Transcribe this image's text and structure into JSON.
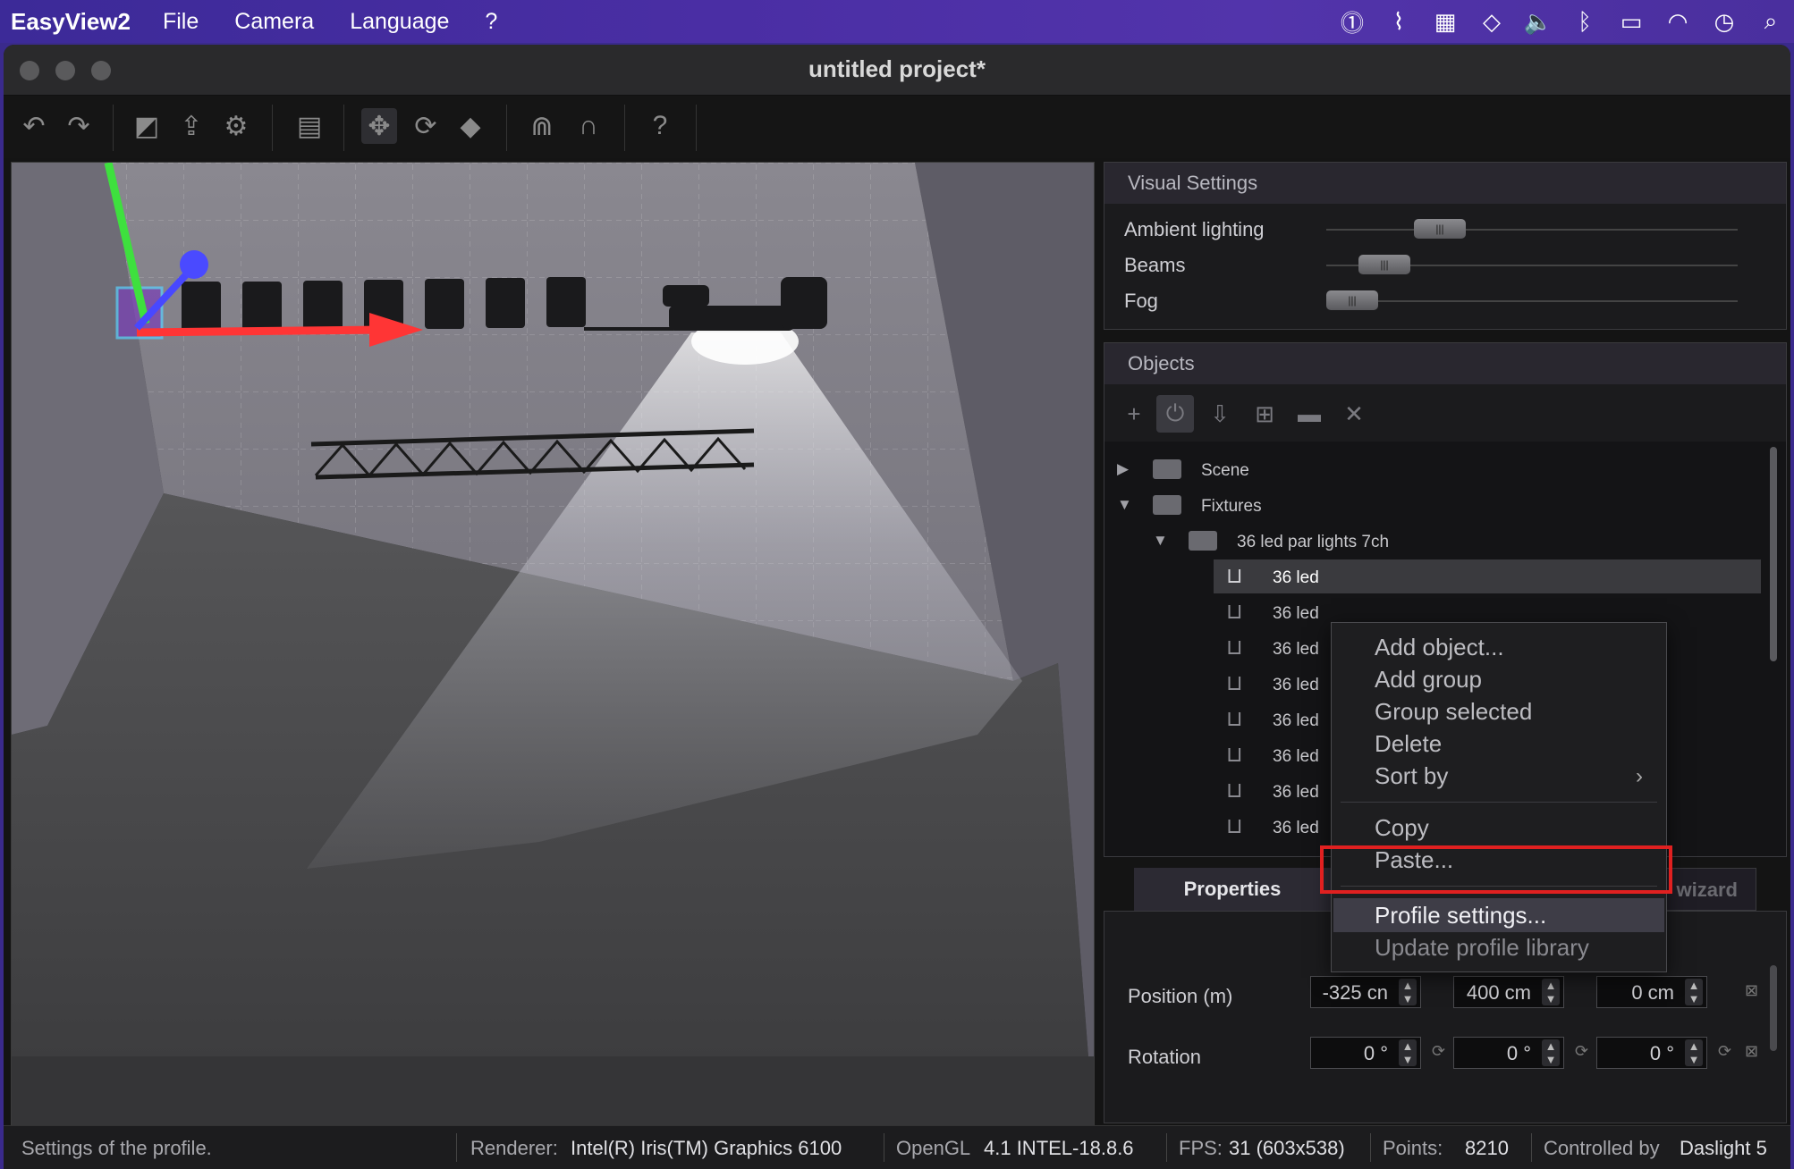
{
  "menubar": {
    "app": "EasyView2",
    "items": [
      "File",
      "Camera",
      "Language",
      "?"
    ],
    "status_icons": [
      "1password-icon",
      "paperclip-icon",
      "layout-icon",
      "diamond-icon",
      "volume-icon",
      "bluetooth-icon",
      "battery-icon",
      "wifi-icon",
      "clock-icon",
      "search-icon"
    ]
  },
  "window": {
    "title": "untitled project*"
  },
  "toolbar": {
    "icons": [
      "undo-icon",
      "redo-icon",
      "fullscreen-icon",
      "export-icon",
      "settings-icon",
      "chart-icon",
      "move-icon",
      "rotate-icon",
      "pin-icon",
      "truss-icon",
      "magnet-icon",
      "help-icon"
    ]
  },
  "visual_settings": {
    "title": "Visual Settings",
    "sliders": [
      {
        "label": "Ambient lighting",
        "value": 0.28
      },
      {
        "label": "Beams",
        "value": 0.14
      },
      {
        "label": "Fog",
        "value": 0.05
      }
    ]
  },
  "objects": {
    "title": "Objects",
    "toolbar_icons": [
      "add-icon",
      "add-fixture-icon",
      "import-icon",
      "add-folder-icon",
      "folder-icon",
      "delete-icon"
    ],
    "tree": [
      {
        "label": "Scene",
        "type": "folder",
        "expanded": false
      },
      {
        "label": "Fixtures",
        "type": "folder",
        "expanded": true
      },
      {
        "label": "36 led par lights 7ch",
        "type": "folder",
        "expanded": true
      },
      {
        "label": "36 led",
        "type": "fixture",
        "selected": true
      },
      {
        "label": "36 led",
        "type": "fixture"
      },
      {
        "label": "36 led",
        "type": "fixture"
      },
      {
        "label": "36 led",
        "type": "fixture"
      },
      {
        "label": "36 led",
        "type": "fixture"
      },
      {
        "label": "36 led",
        "type": "fixture"
      },
      {
        "label": "36 led",
        "type": "fixture"
      },
      {
        "label": "36 led",
        "type": "fixture"
      }
    ]
  },
  "context_menu": {
    "group1": [
      "Add object...",
      "Add group",
      "Group selected",
      "Delete",
      "Sort by"
    ],
    "group2": [
      "Copy",
      "Paste..."
    ],
    "group3": [
      "Profile settings...",
      "Update profile library"
    ],
    "highlighted": "Profile settings..."
  },
  "properties": {
    "tabs": [
      "Properties",
      "wizard"
    ],
    "position_label": "Position (m)",
    "position": [
      "-325 cn",
      "400 cm",
      "0 cm"
    ],
    "rotation_label": "Rotation",
    "rotation": [
      "0 °",
      "0 °",
      "0 °"
    ]
  },
  "statusbar": {
    "hint": "Settings of the profile.",
    "renderer_label": "Renderer:",
    "renderer": "Intel(R) Iris(TM) Graphics 6100",
    "opengl_label": "OpenGL",
    "opengl": "4.1 INTEL-18.8.6",
    "fps_label": "FPS:",
    "fps": "31 (603x538)",
    "points_label": "Points:",
    "points": "8210",
    "controlled_label": "Controlled by",
    "controlled": "Daslight 5"
  },
  "colors": {
    "menubar": "#4a2ea4",
    "highlight_box": "#e02020",
    "axis_x": "#ff3030",
    "axis_y": "#30e030",
    "axis_z": "#4040ff"
  }
}
